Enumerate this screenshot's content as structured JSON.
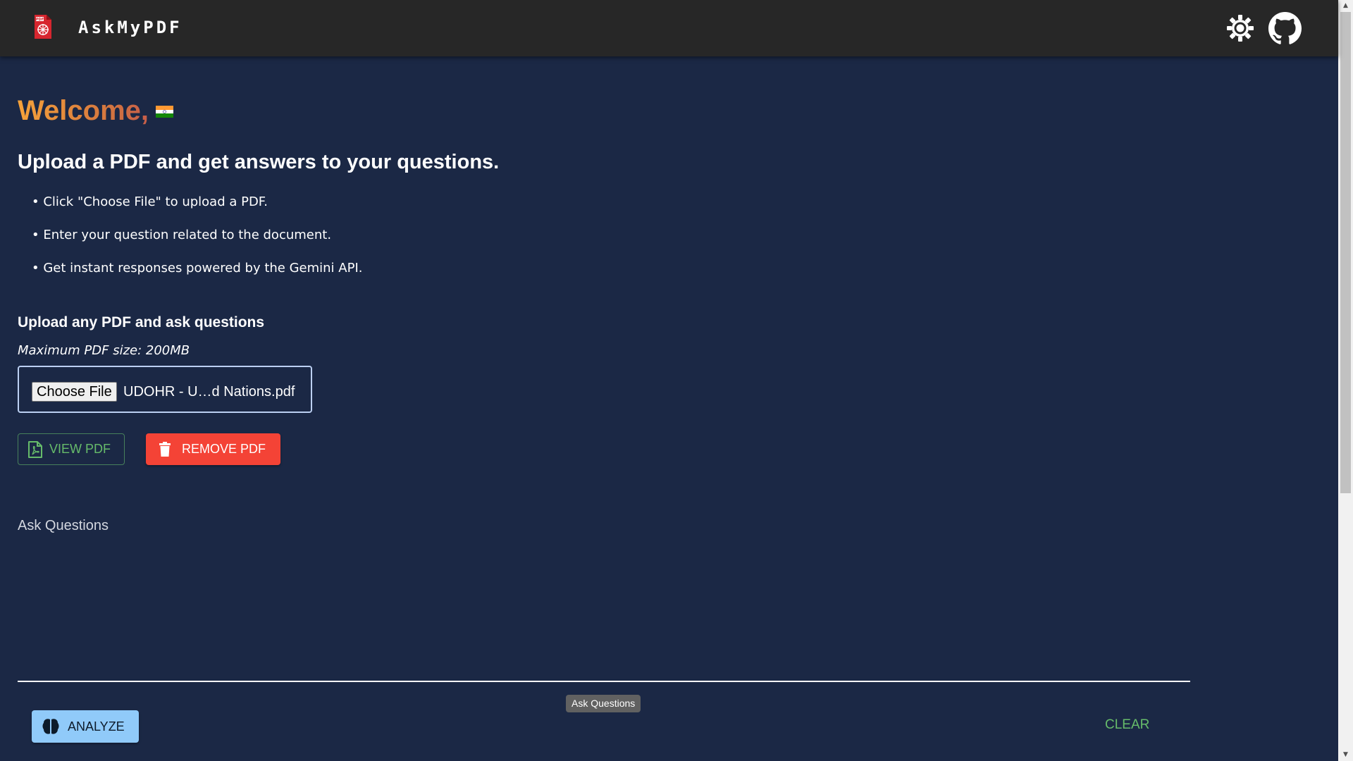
{
  "header": {
    "brand": "AskMyPDF",
    "logo_icon": "pdf-file-icon",
    "theme_toggle_icon": "sun-icon",
    "github_icon": "github-icon",
    "background": "#272727"
  },
  "intro": {
    "welcome": "Welcome,",
    "flag_icon": "india-flag-icon",
    "headline": "Upload a PDF and get answers to your questions.",
    "bullets": [
      "• Click \"Choose File\" to upload a PDF.",
      "• Enter your question related to the document.",
      "• Get instant responses powered by the Gemini API."
    ]
  },
  "upload": {
    "title": "Upload any PDF and ask questions",
    "max_size": "Maximum PDF size: 200MB",
    "choose_file_label": "Choose File",
    "file_name": "UDOHR - U…d Nations.pdf",
    "view_pdf_label": "VIEW PDF",
    "remove_pdf_label": "REMOVE PDF",
    "view_pdf_icon": "pdf-file-icon",
    "remove_pdf_icon": "trash-icon"
  },
  "question": {
    "label": "Ask Questions",
    "value": "",
    "tooltip": "Ask Questions"
  },
  "actions": {
    "analyze_label": "ANALYZE",
    "analyze_icon": "brain-icon",
    "clear_label": "CLEAR"
  },
  "colors": {
    "page_background": "#1b2845",
    "accent_green": "#66bb6a",
    "danger_red": "#f44336",
    "analyze_blue": "#90caf9",
    "welcome_gradient_start": "#f5a23a",
    "welcome_gradient_end": "#c65d4a"
  }
}
